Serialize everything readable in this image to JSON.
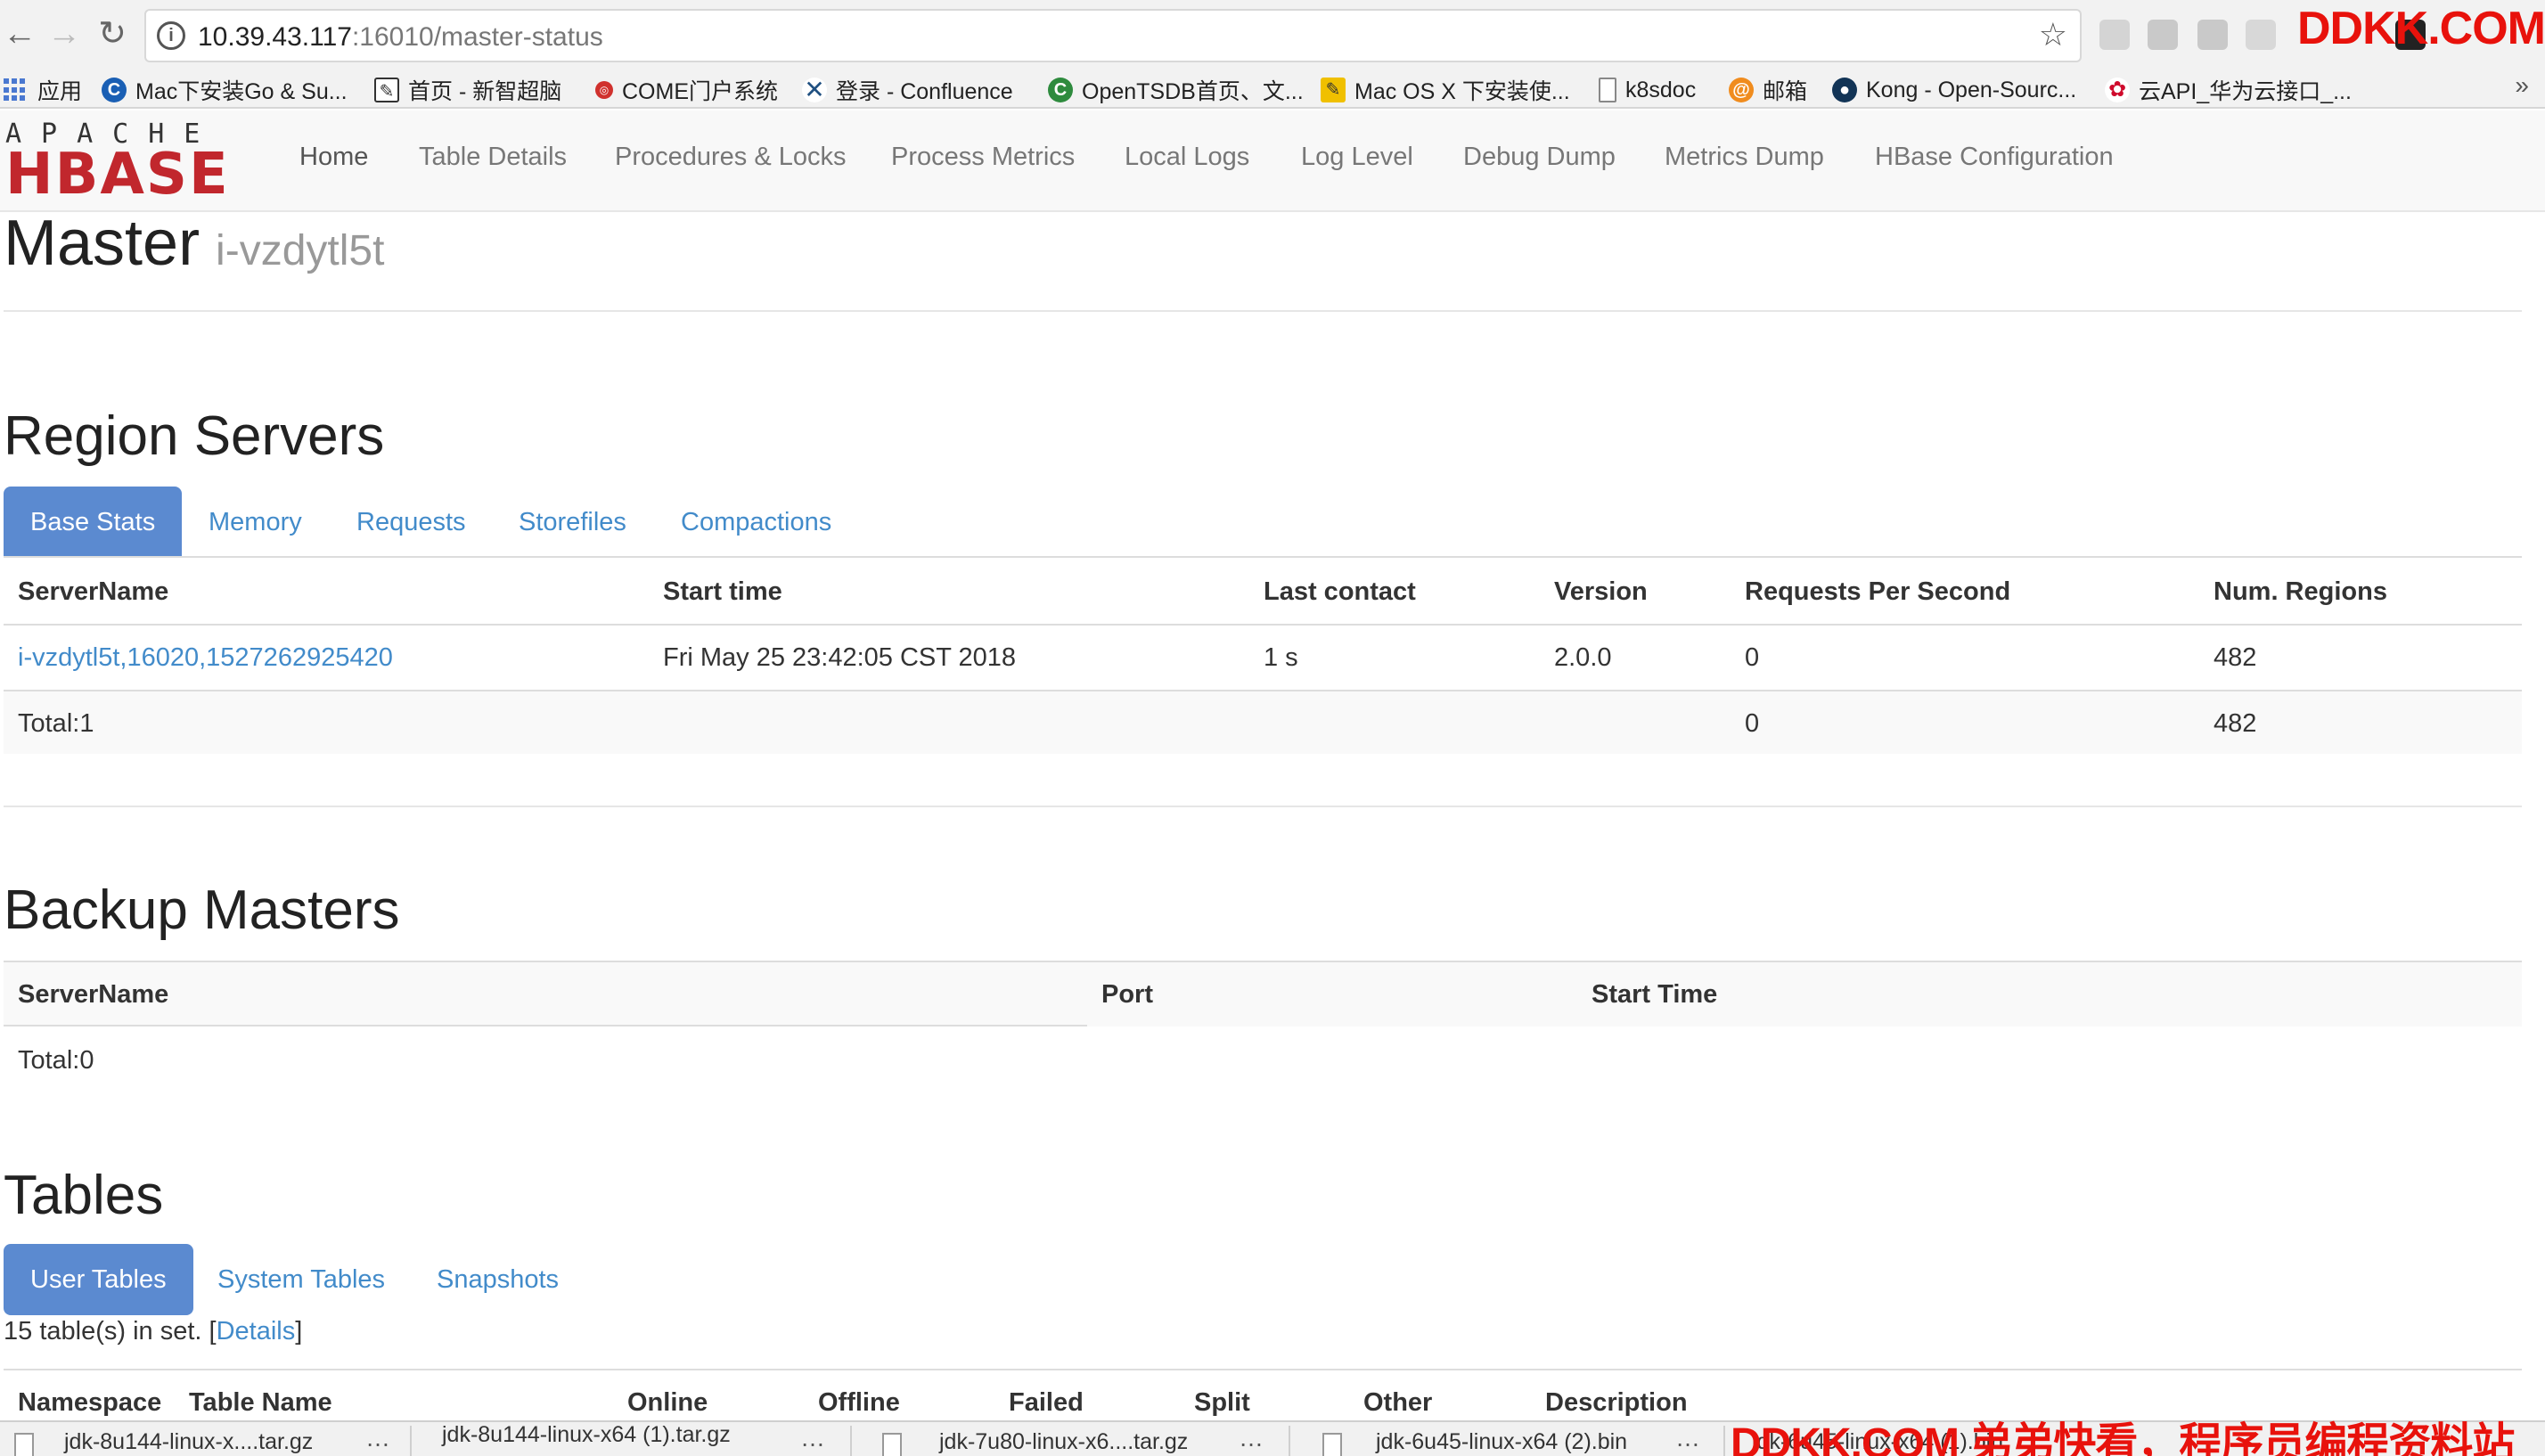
{
  "browser": {
    "url_host": "10.39.43.117",
    "url_path": ":16010/master-status",
    "watermark_top": "DDKK.COM",
    "watermark_bottom": "DDKK.COM 弟弟快看，程序员编程资料站"
  },
  "bookmarks": [
    {
      "label": "应用",
      "icon": "apps-grid-icon"
    },
    {
      "label": "Mac下安装Go & Su...",
      "icon": "c-logo-icon",
      "color": "#1a5fb4"
    },
    {
      "label": "首页 - 新智超脑",
      "icon": "edit-icon",
      "color": "#333333"
    },
    {
      "label": "COME门户系统",
      "icon": "come-logo-icon",
      "color": "#d0312d"
    },
    {
      "label": "登录 - Confluence",
      "icon": "confluence-icon",
      "color": "#205081"
    },
    {
      "label": "OpenTSDB首页、文...",
      "icon": "c-logo-icon",
      "color": "#2e8b3e"
    },
    {
      "label": "Mac OS X 下安装使...",
      "icon": "note-icon",
      "color": "#f0c000"
    },
    {
      "label": "k8sdoc",
      "icon": "page-icon",
      "color": "#888888"
    },
    {
      "label": "邮箱",
      "icon": "mail-icon",
      "color": "#f08c1e"
    },
    {
      "label": "Kong - Open-Sourc...",
      "icon": "kong-icon",
      "color": "#123456"
    },
    {
      "label": "云API_华为云接口_...",
      "icon": "huawei-icon",
      "color": "#cf0a2c"
    }
  ],
  "navbar": {
    "logo_top": "APACHE",
    "logo_main": "HBASE",
    "items": [
      "Home",
      "Table Details",
      "Procedures & Locks",
      "Process Metrics",
      "Local Logs",
      "Log Level",
      "Debug Dump",
      "Metrics Dump",
      "HBase Configuration"
    ]
  },
  "master": {
    "title": "Master",
    "host": "i-vzdytl5t"
  },
  "region_servers": {
    "heading": "Region Servers",
    "tabs": [
      "Base Stats",
      "Memory",
      "Requests",
      "Storefiles",
      "Compactions"
    ],
    "columns": [
      "ServerName",
      "Start time",
      "Last contact",
      "Version",
      "Requests Per Second",
      "Num. Regions"
    ],
    "rows": [
      {
        "server": "i-vzdytl5t,16020,1527262925420",
        "start": "Fri May 25 23:42:05 CST 2018",
        "last_contact": "1 s",
        "version": "2.0.0",
        "rps": "0",
        "regions": "482"
      }
    ],
    "total": {
      "label": "Total:1",
      "rps": "0",
      "regions": "482"
    }
  },
  "backup_masters": {
    "heading": "Backup Masters",
    "columns": [
      "ServerName",
      "Port",
      "Start Time"
    ],
    "total": "Total:0"
  },
  "tables": {
    "heading": "Tables",
    "tabs": [
      "User Tables",
      "System Tables",
      "Snapshots"
    ],
    "count_text": "15 table(s) in set. [",
    "details_link": "Details",
    "count_close": "]",
    "columns": [
      "Namespace",
      "Table Name",
      "Online",
      "Offline",
      "Failed",
      "Split",
      "Other",
      "Description"
    ]
  },
  "downloads": [
    "jdk-8u144-linux-x....tar.gz",
    "jdk-8u144-linux-x64 (1).tar.gz",
    "jdk-7u80-linux-x6....tar.gz",
    "jdk-6u45-linux-x64 (2).bin",
    "jdk-6u45-linux-x64 (1).bin"
  ]
}
